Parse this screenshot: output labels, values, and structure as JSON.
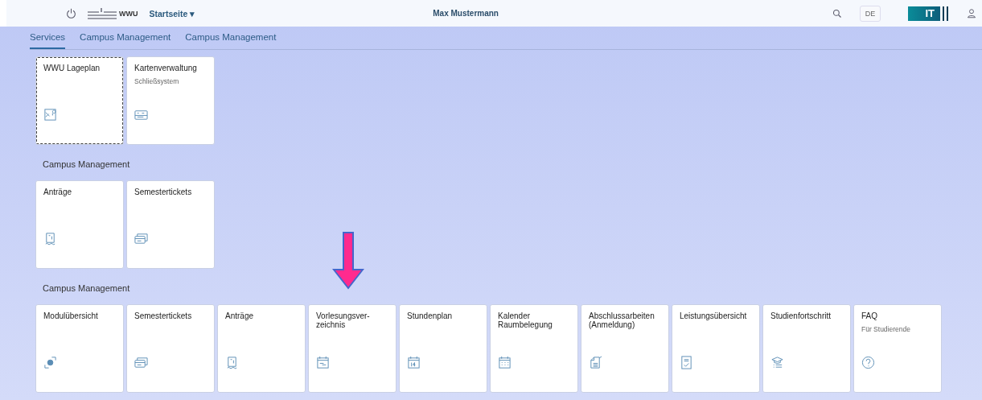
{
  "header": {
    "app_title": "Startseite ▾",
    "logo_text": "WWU",
    "user": "Max Mustermann",
    "language": "DE",
    "brand": "IT"
  },
  "tabs": [
    {
      "label": "Services",
      "selected": true
    },
    {
      "label": "Campus Management",
      "selected": false
    },
    {
      "label": "Campus Management",
      "selected": false
    }
  ],
  "sections": [
    {
      "tiles": [
        {
          "title": "WWU Lageplan",
          "focused": true
        },
        {
          "title": "Kartenverwaltung",
          "subtitle": "Schließsystem",
          "focused": false
        }
      ]
    },
    {
      "heading": "Campus Management",
      "tiles": [
        {
          "title": "Anträge",
          "focused": false
        },
        {
          "title": "Semestertickets",
          "focused": false
        }
      ]
    },
    {
      "heading": "Campus Management",
      "tiles": [
        {
          "title": "Modulübersicht",
          "focused": false
        },
        {
          "title": "Semestertickets",
          "focused": false
        },
        {
          "title": "Anträge",
          "focused": false
        },
        {
          "title": "Vorlesungsver-\nzeichnis",
          "focused": false
        },
        {
          "title": "Stundenplan",
          "focused": false
        },
        {
          "title": "Kalender\nRaumbelegung",
          "focused": false
        },
        {
          "title": "Abschlussarbeiten\n(Anmeldung)",
          "focused": false
        },
        {
          "title": "Leistungsübersicht",
          "focused": false
        },
        {
          "title": "Studienfortschritt",
          "focused": false
        },
        {
          "title": "FAQ",
          "subtitle": "Für Studierende",
          "focused": false
        }
      ]
    }
  ]
}
